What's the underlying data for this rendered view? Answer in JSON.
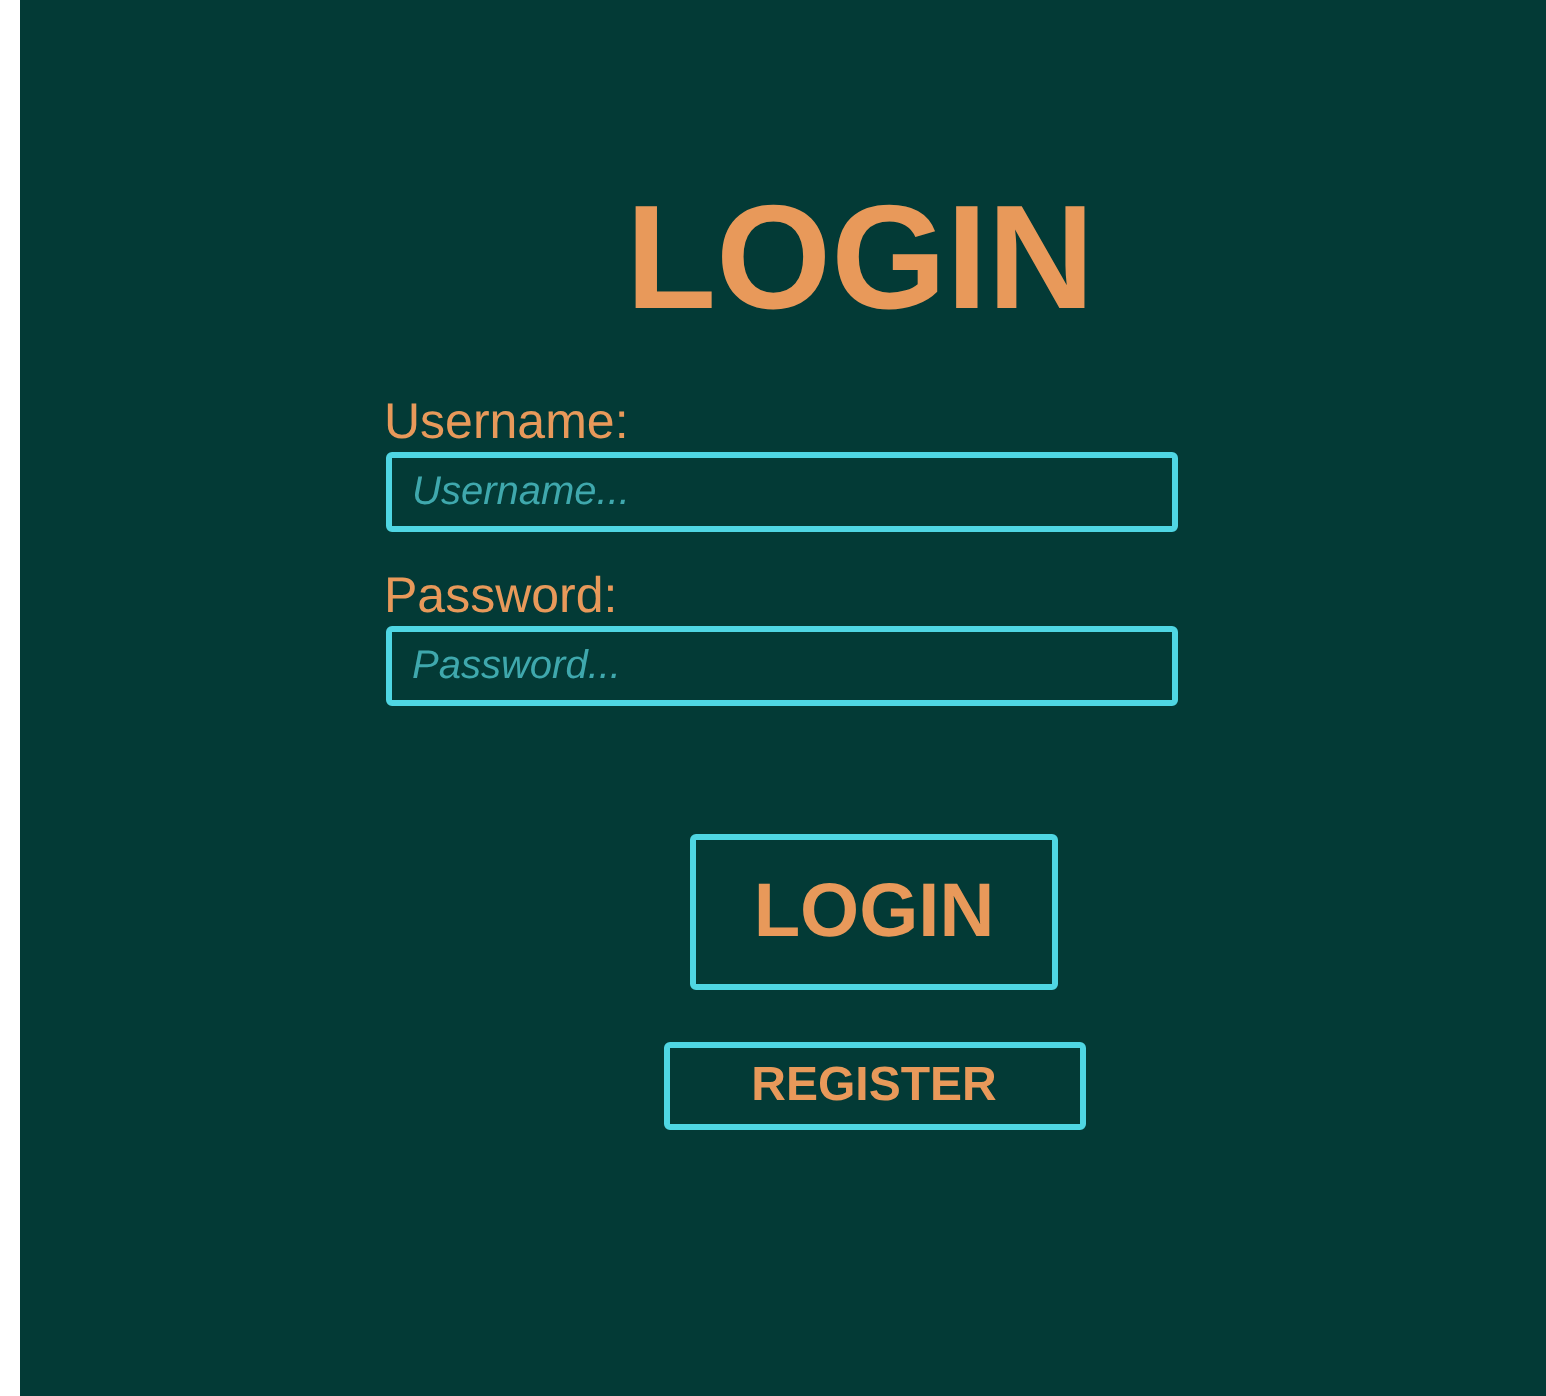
{
  "title": "LOGIN",
  "fields": [
    {
      "label": "Username:",
      "placeholder": "Username..."
    },
    {
      "label": "Password:",
      "placeholder": "Password..."
    }
  ],
  "buttons": [
    {
      "label": "LOGIN",
      "kind": "primary"
    },
    {
      "label": "REGISTER",
      "kind": "secondary"
    }
  ]
}
